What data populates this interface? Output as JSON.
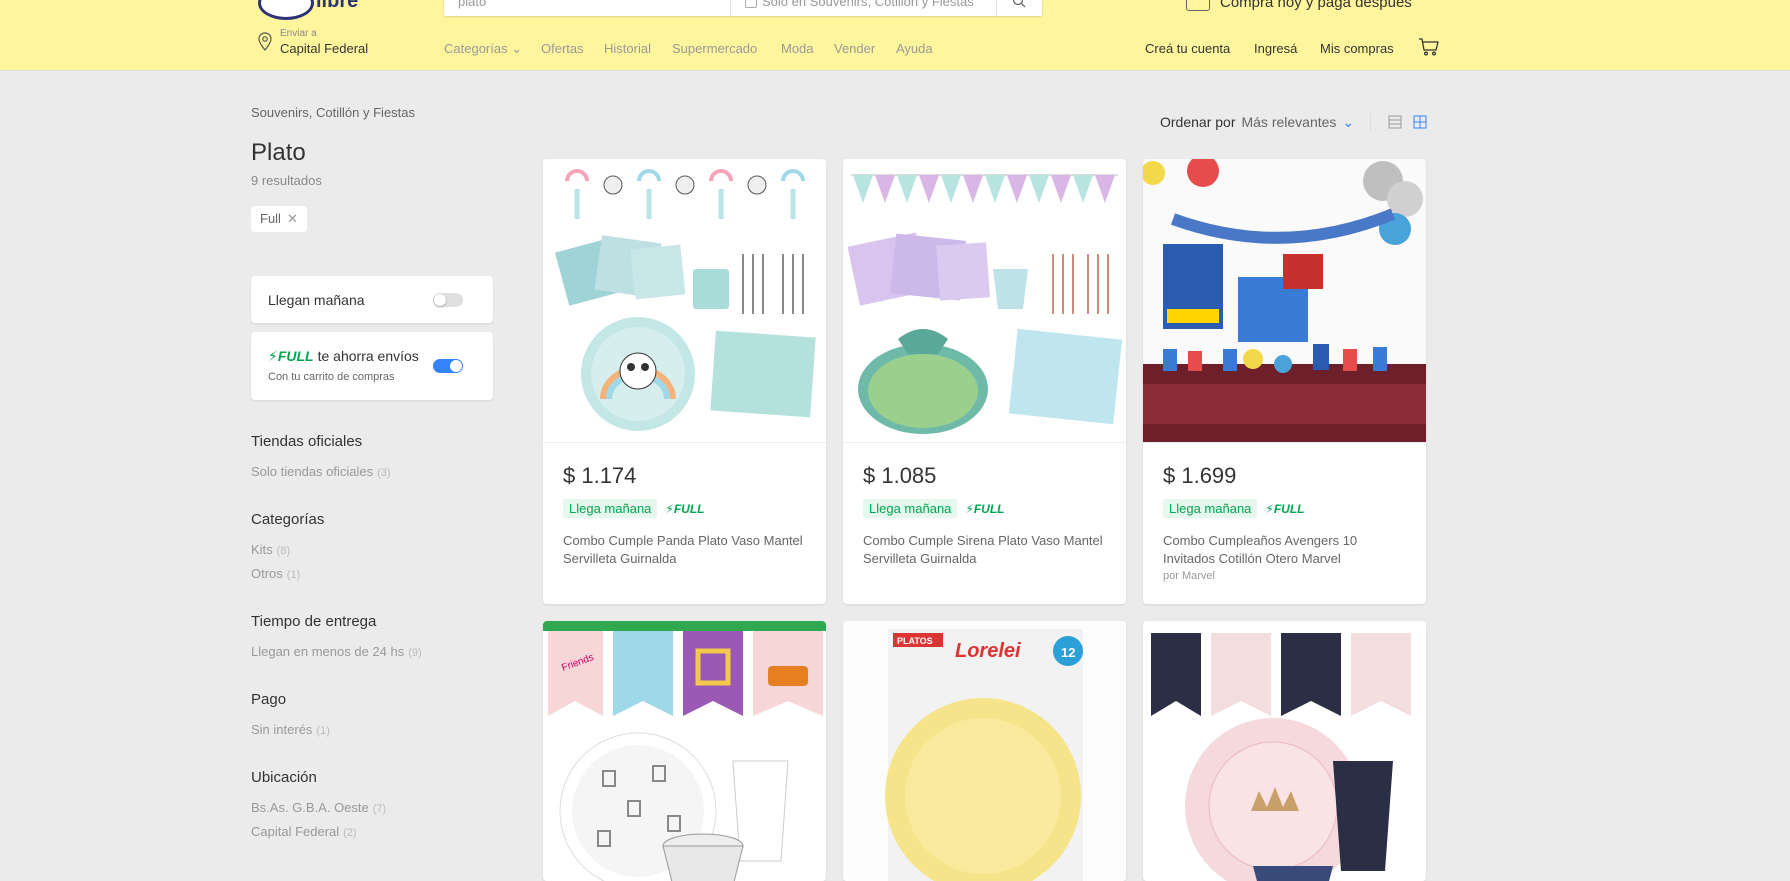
{
  "header": {
    "logo_text": "libre",
    "search_query": "plato",
    "search_only_label": "Solo en Souvenirs, Cotillón y Fiestas",
    "promo": "Comprá hoy y pagá después",
    "ship_label": "Enviar a",
    "ship_location": "Capital Federal",
    "nav": [
      {
        "label": "Categorías ⌄"
      },
      {
        "label": "Ofertas"
      },
      {
        "label": "Historial"
      },
      {
        "label": "Supermercado"
      },
      {
        "label": "Moda"
      },
      {
        "label": "Vender"
      },
      {
        "label": "Ayuda"
      }
    ],
    "account": {
      "create": "Creá tu cuenta",
      "login": "Ingresá",
      "purchases": "Mis compras"
    }
  },
  "sidebar": {
    "breadcrumb": "Souvenirs, Cotillón y Fiestas",
    "title": "Plato",
    "results": "9 resultados",
    "chip": "Full",
    "arrive_tomorrow": "Llegan mañana",
    "full_brand": "FULL",
    "full_text": "te ahorra envíos",
    "full_sub": "Con tu carrito de compras",
    "filters": [
      {
        "title": "Tiendas oficiales",
        "items": [
          {
            "label": "Solo tiendas oficiales",
            "count": "(3)"
          }
        ]
      },
      {
        "title": "Categorías",
        "items": [
          {
            "label": "Kits",
            "count": "(8)"
          },
          {
            "label": "Otros",
            "count": "(1)"
          }
        ]
      },
      {
        "title": "Tiempo de entrega",
        "items": [
          {
            "label": "Llegan en menos de 24 hs",
            "count": "(9)"
          }
        ]
      },
      {
        "title": "Pago",
        "items": [
          {
            "label": "Sin interés",
            "count": "(1)"
          }
        ]
      },
      {
        "title": "Ubicación",
        "items": [
          {
            "label": "Bs.As. G.B.A. Oeste",
            "count": "(7)"
          },
          {
            "label": "Capital Federal",
            "count": "(2)"
          }
        ]
      }
    ]
  },
  "sort": {
    "label": "Ordenar por",
    "value": "Más relevantes"
  },
  "products": [
    {
      "price": "$ 1.174",
      "arrives": "Llega mañana",
      "full": "FULL",
      "title": "Combo Cumple Panda Plato Vaso Mantel Servilleta Guirnalda",
      "seller": ""
    },
    {
      "price": "$ 1.085",
      "arrives": "Llega mañana",
      "full": "FULL",
      "title": "Combo Cumple Sirena Plato Vaso Mantel Servilleta Guirnalda",
      "seller": ""
    },
    {
      "price": "$ 1.699",
      "arrives": "Llega mañana",
      "full": "FULL",
      "title": "Combo Cumpleaños Avengers 10 Invitados Cotillón Otero Marvel",
      "seller": "por Marvel"
    },
    {
      "image_text": "Friends"
    },
    {
      "image_text": "Lorelei",
      "badge": "PLATOS",
      "count": "12"
    },
    {
      "image_text": ""
    }
  ],
  "colors": {
    "header_bg": "#fff59d",
    "accent_blue": "#3483fa",
    "green": "#00a650",
    "page_bg": "#ebebeb"
  }
}
